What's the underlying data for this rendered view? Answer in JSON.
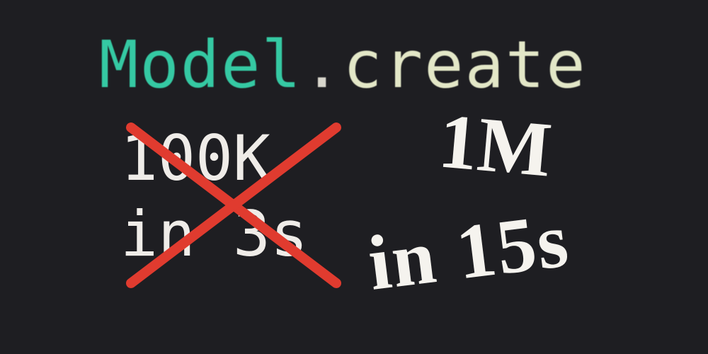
{
  "code": {
    "class": "Model",
    "dot": ".",
    "method": "create"
  },
  "old": {
    "line1": "100K",
    "line2": "in 3s"
  },
  "new": {
    "line1": "1M",
    "line2": "in 15s"
  }
}
